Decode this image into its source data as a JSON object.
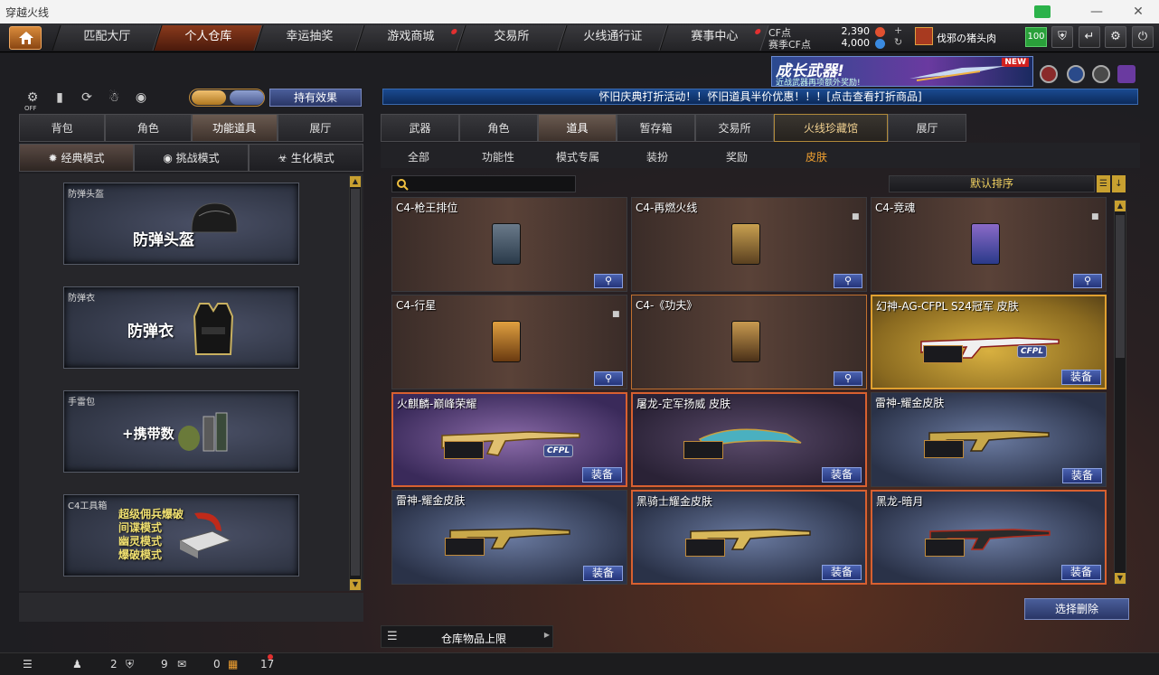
{
  "window": {
    "title": "穿越火线"
  },
  "nav": {
    "tabs": [
      {
        "label": "匹配大厅"
      },
      {
        "label": "个人仓库"
      },
      {
        "label": "幸运抽奖"
      },
      {
        "label": "游戏商城"
      },
      {
        "label": "交易所"
      },
      {
        "label": "火线通行证"
      },
      {
        "label": "赛事中心"
      }
    ],
    "cf_label": "CF点",
    "cf_value": "2,390",
    "match_cf_label": "赛季CF点",
    "match_cf_value": "4,000",
    "player_name": "伐邪の猪头肉",
    "level": "100"
  },
  "ad": {
    "title": "成长武器!",
    "subtitle": "近战武器再项额外奖励!",
    "badge": "NEW"
  },
  "left": {
    "effect_button": "持有效果",
    "toggle_off": "OFF",
    "tabs": [
      {
        "label": "背包"
      },
      {
        "label": "角色"
      },
      {
        "label": "功能道具"
      },
      {
        "label": "展厅"
      }
    ],
    "modes": [
      {
        "label": "经典模式"
      },
      {
        "label": "挑战模式"
      },
      {
        "label": "生化模式"
      }
    ],
    "slots": [
      {
        "label": "防弹头盔",
        "big": "防弹头盔"
      },
      {
        "label": "防弹衣",
        "big": "防弹衣"
      },
      {
        "label": "手雷包",
        "big": "+携带数"
      },
      {
        "label": "C4工具箱",
        "lines": [
          "超级佣兵爆破",
          "间谍模式",
          "幽灵模式",
          "爆破模式"
        ]
      }
    ]
  },
  "banner": "怀旧庆典打折活动！！怀旧道具半价优惠！！！[点击查看打折商品]",
  "right": {
    "tabs": [
      {
        "label": "武器"
      },
      {
        "label": "角色"
      },
      {
        "label": "道具"
      },
      {
        "label": "暂存箱"
      },
      {
        "label": "交易所"
      },
      {
        "label": "火线珍藏馆"
      },
      {
        "label": "展厅"
      }
    ],
    "subtabs": [
      {
        "label": "全部"
      },
      {
        "label": "功能性"
      },
      {
        "label": "模式专属"
      },
      {
        "label": "装扮"
      },
      {
        "label": "奖励"
      },
      {
        "label": "皮肤"
      }
    ],
    "sort_label": "默认排序",
    "equip_label": "装备",
    "cpl_label": "CFPL",
    "items": [
      {
        "name": "C4-枪王排位"
      },
      {
        "name": "C4-再燃火线"
      },
      {
        "name": "C4-竞魂"
      },
      {
        "name": "C4-行星"
      },
      {
        "name": "C4-《功夫》"
      },
      {
        "name": "幻神-AG-CFPL S24冠军 皮肤"
      },
      {
        "name": "火麒麟-巅峰荣耀"
      },
      {
        "name": "屠龙-定军扬威 皮肤"
      },
      {
        "name": "雷神-耀金皮肤"
      },
      {
        "name": "雷神-耀金皮肤"
      },
      {
        "name": "黑骑士耀金皮肤"
      },
      {
        "name": "黑龙-暗月"
      }
    ],
    "delete_button": "选择删除",
    "capacity_label": "仓库物品上限"
  },
  "status": {
    "friends": "2",
    "messages": "9",
    "gifts": "0",
    "notifications": "17"
  }
}
